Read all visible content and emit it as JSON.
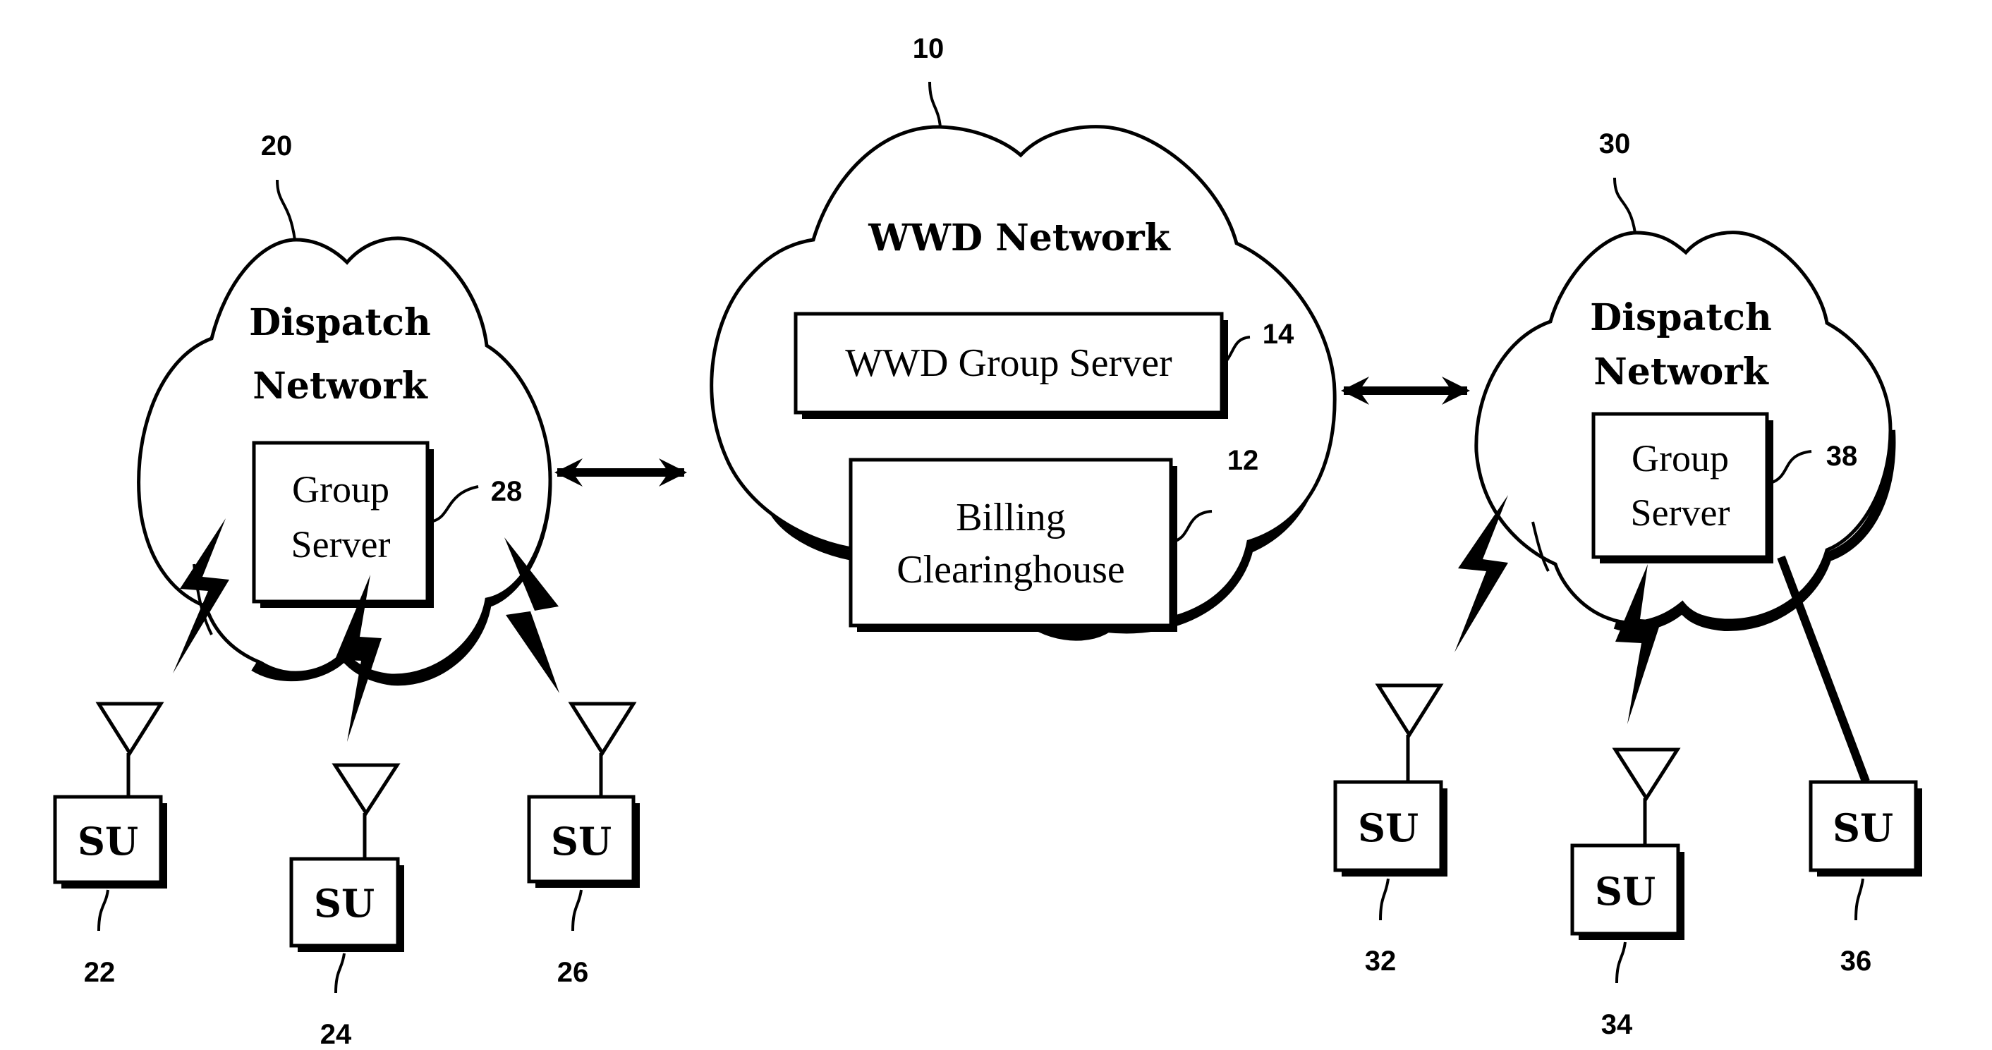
{
  "diagram": {
    "wwd_network": {
      "ref": "10",
      "title": "WWD Network",
      "group_server": {
        "ref": "14",
        "label": "WWD Group Server"
      },
      "billing": {
        "ref": "12",
        "line1": "Billing",
        "line2": "Clearinghouse"
      }
    },
    "left_dispatch": {
      "ref": "20",
      "title_line1": "Dispatch",
      "title_line2": "Network",
      "group_server": {
        "ref": "28",
        "line1": "Group",
        "line2": "Server"
      },
      "subscriber_units": [
        {
          "ref": "22",
          "label": "SU",
          "link": "wireless"
        },
        {
          "ref": "24",
          "label": "SU",
          "link": "wireless"
        },
        {
          "ref": "26",
          "label": "SU",
          "link": "wireless"
        }
      ]
    },
    "right_dispatch": {
      "ref": "30",
      "title_line1": "Dispatch",
      "title_line2": "Network",
      "group_server": {
        "ref": "38",
        "line1": "Group",
        "line2": "Server"
      },
      "subscriber_units": [
        {
          "ref": "32",
          "label": "SU",
          "link": "wireless"
        },
        {
          "ref": "34",
          "label": "SU",
          "link": "wireless"
        },
        {
          "ref": "36",
          "label": "SU",
          "link": "wired"
        }
      ]
    },
    "connections": [
      {
        "from": "Dispatch Network 20",
        "to": "WWD Network 10",
        "type": "bidirectional"
      },
      {
        "from": "WWD Network 10",
        "to": "Dispatch Network 30",
        "type": "bidirectional"
      }
    ]
  }
}
